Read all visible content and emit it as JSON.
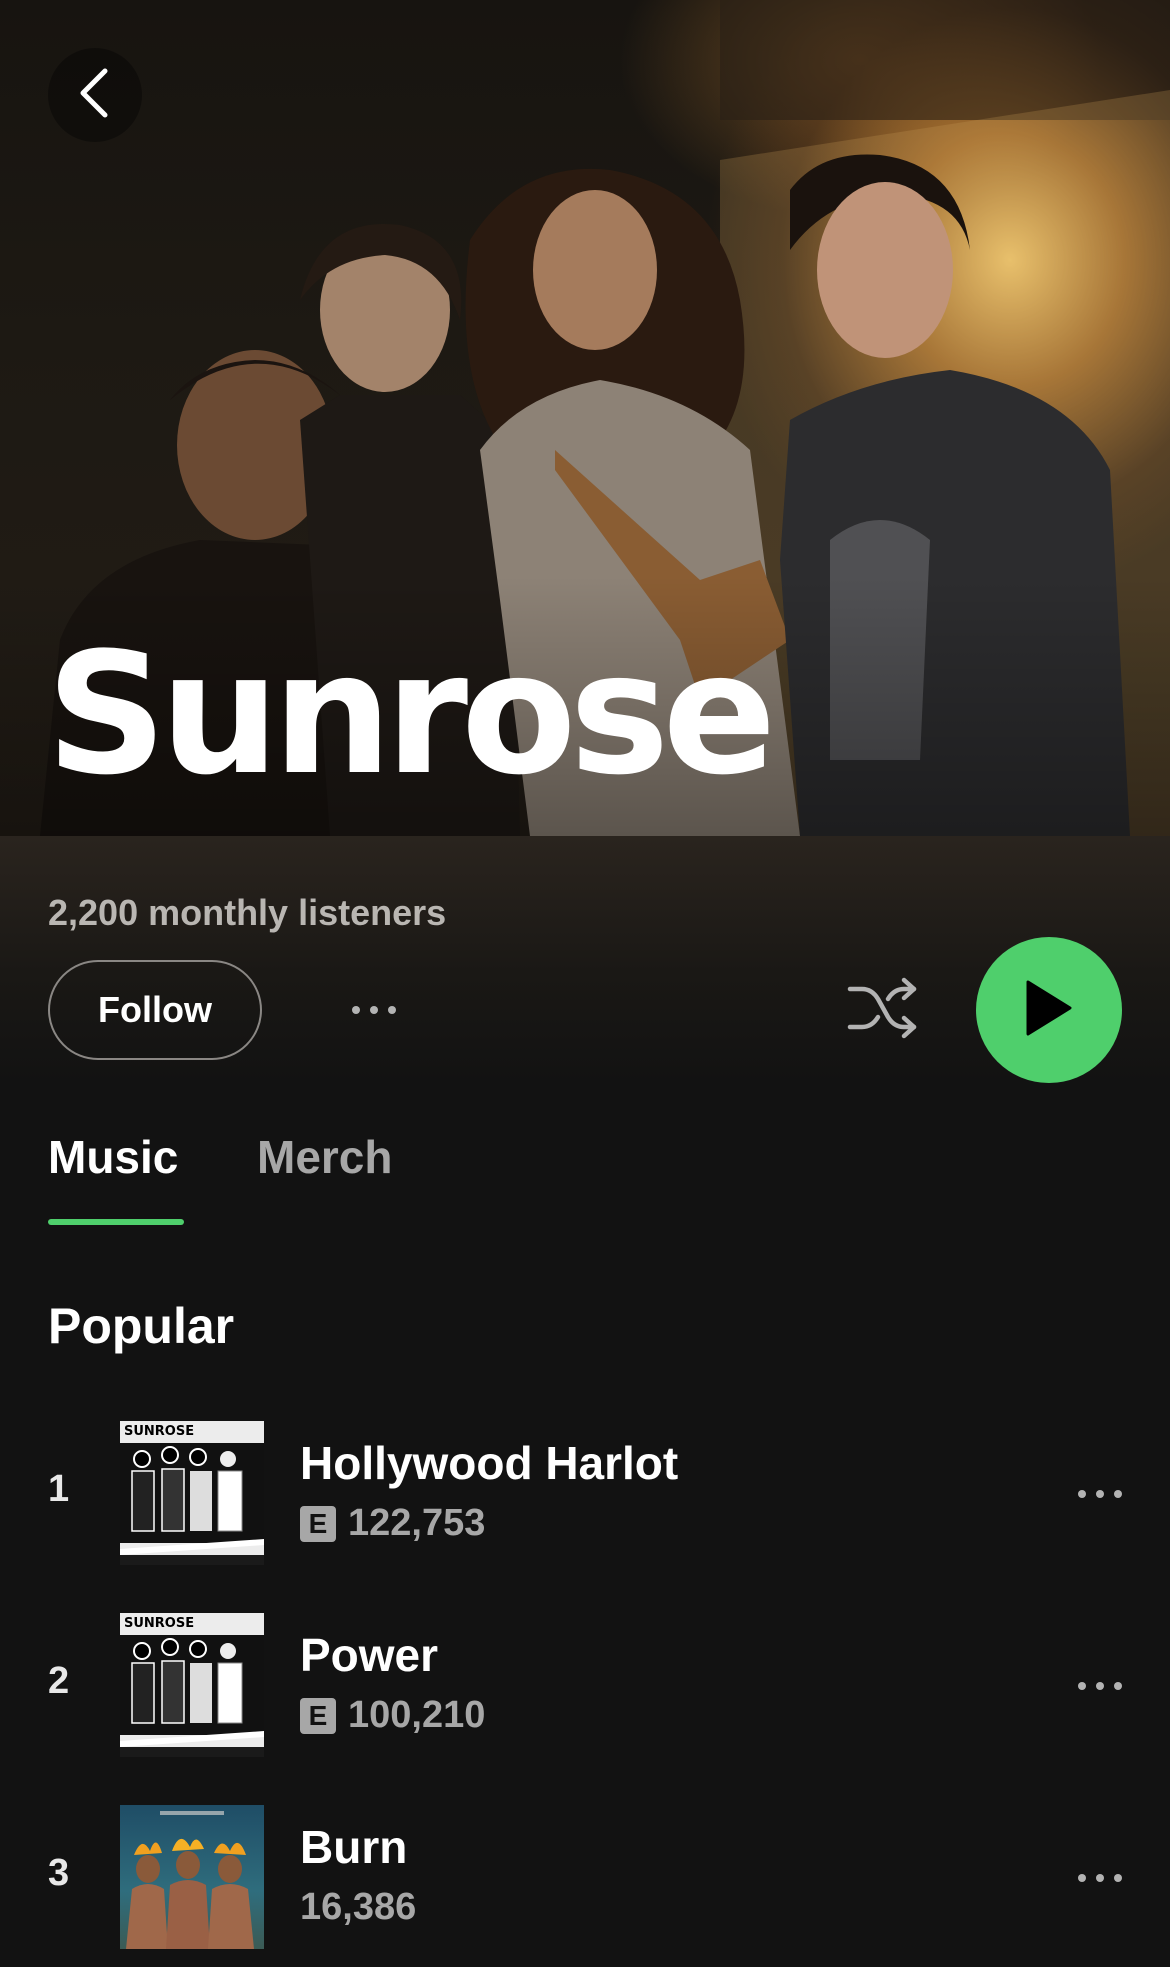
{
  "artist": {
    "name": "Sunrose",
    "monthly_listeners": "2,200 monthly listeners"
  },
  "actions": {
    "follow_label": "Follow"
  },
  "tabs": [
    {
      "label": "Music",
      "active": true
    },
    {
      "label": "Merch",
      "active": false
    }
  ],
  "popular": {
    "title": "Popular",
    "tracks": [
      {
        "rank": "1",
        "title": "Hollywood Harlot",
        "explicit": "E",
        "plays": "122,753",
        "cover_text": "SUNROSE"
      },
      {
        "rank": "2",
        "title": "Power",
        "explicit": "E",
        "plays": "100,210",
        "cover_text": "SUNROSE"
      },
      {
        "rank": "3",
        "title": "Burn",
        "plays": "16,386"
      }
    ]
  },
  "icons": {
    "back": "chevron-left-icon",
    "more": "more-horizontal-icon",
    "shuffle": "shuffle-icon",
    "play": "play-icon"
  },
  "colors": {
    "accent": "#4fcf6c",
    "background": "#121212",
    "secondary_text": "#a7a7a7"
  }
}
